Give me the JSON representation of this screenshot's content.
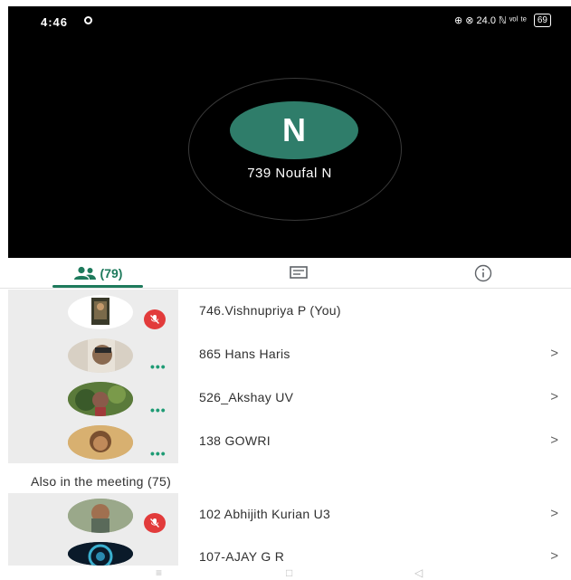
{
  "status_bar": {
    "time": "4:46",
    "indicators": "⊕ ⊗ 24.0 ℕ ᵛᵒˡ ᵗᵉ",
    "battery": "69"
  },
  "speaker": {
    "initial": "N",
    "name": "739 Noufal N",
    "avatar_color": "#2f7d6a"
  },
  "tabs": {
    "people_count": "(79)",
    "people_icon": "people-icon",
    "chat_icon": "chat-icon",
    "info_icon": "info-icon",
    "accent": "#1e7a5c"
  },
  "participants": [
    {
      "name": "746.Vishnupriya P (You)",
      "status": "muted",
      "chevron": ""
    },
    {
      "name": "865 Hans Haris",
      "status": "dots",
      "chevron": ">"
    },
    {
      "name": "526_Akshay UV",
      "status": "dots",
      "chevron": ">"
    },
    {
      "name": "138 GOWRI",
      "status": "dots",
      "chevron": ">"
    }
  ],
  "also_in_meeting": {
    "label": "Also in the meeting (75)",
    "participants": [
      {
        "name": "102 Abhijith Kurian U3",
        "status": "muted",
        "chevron": ">"
      },
      {
        "name": "107-AJAY G R",
        "status": "none",
        "chevron": ">"
      }
    ]
  },
  "nav": {
    "menu": "≡",
    "home": "□",
    "back": "◁"
  },
  "colors": {
    "mic_off": "#e23b3b",
    "dots": "#1e9b74"
  }
}
